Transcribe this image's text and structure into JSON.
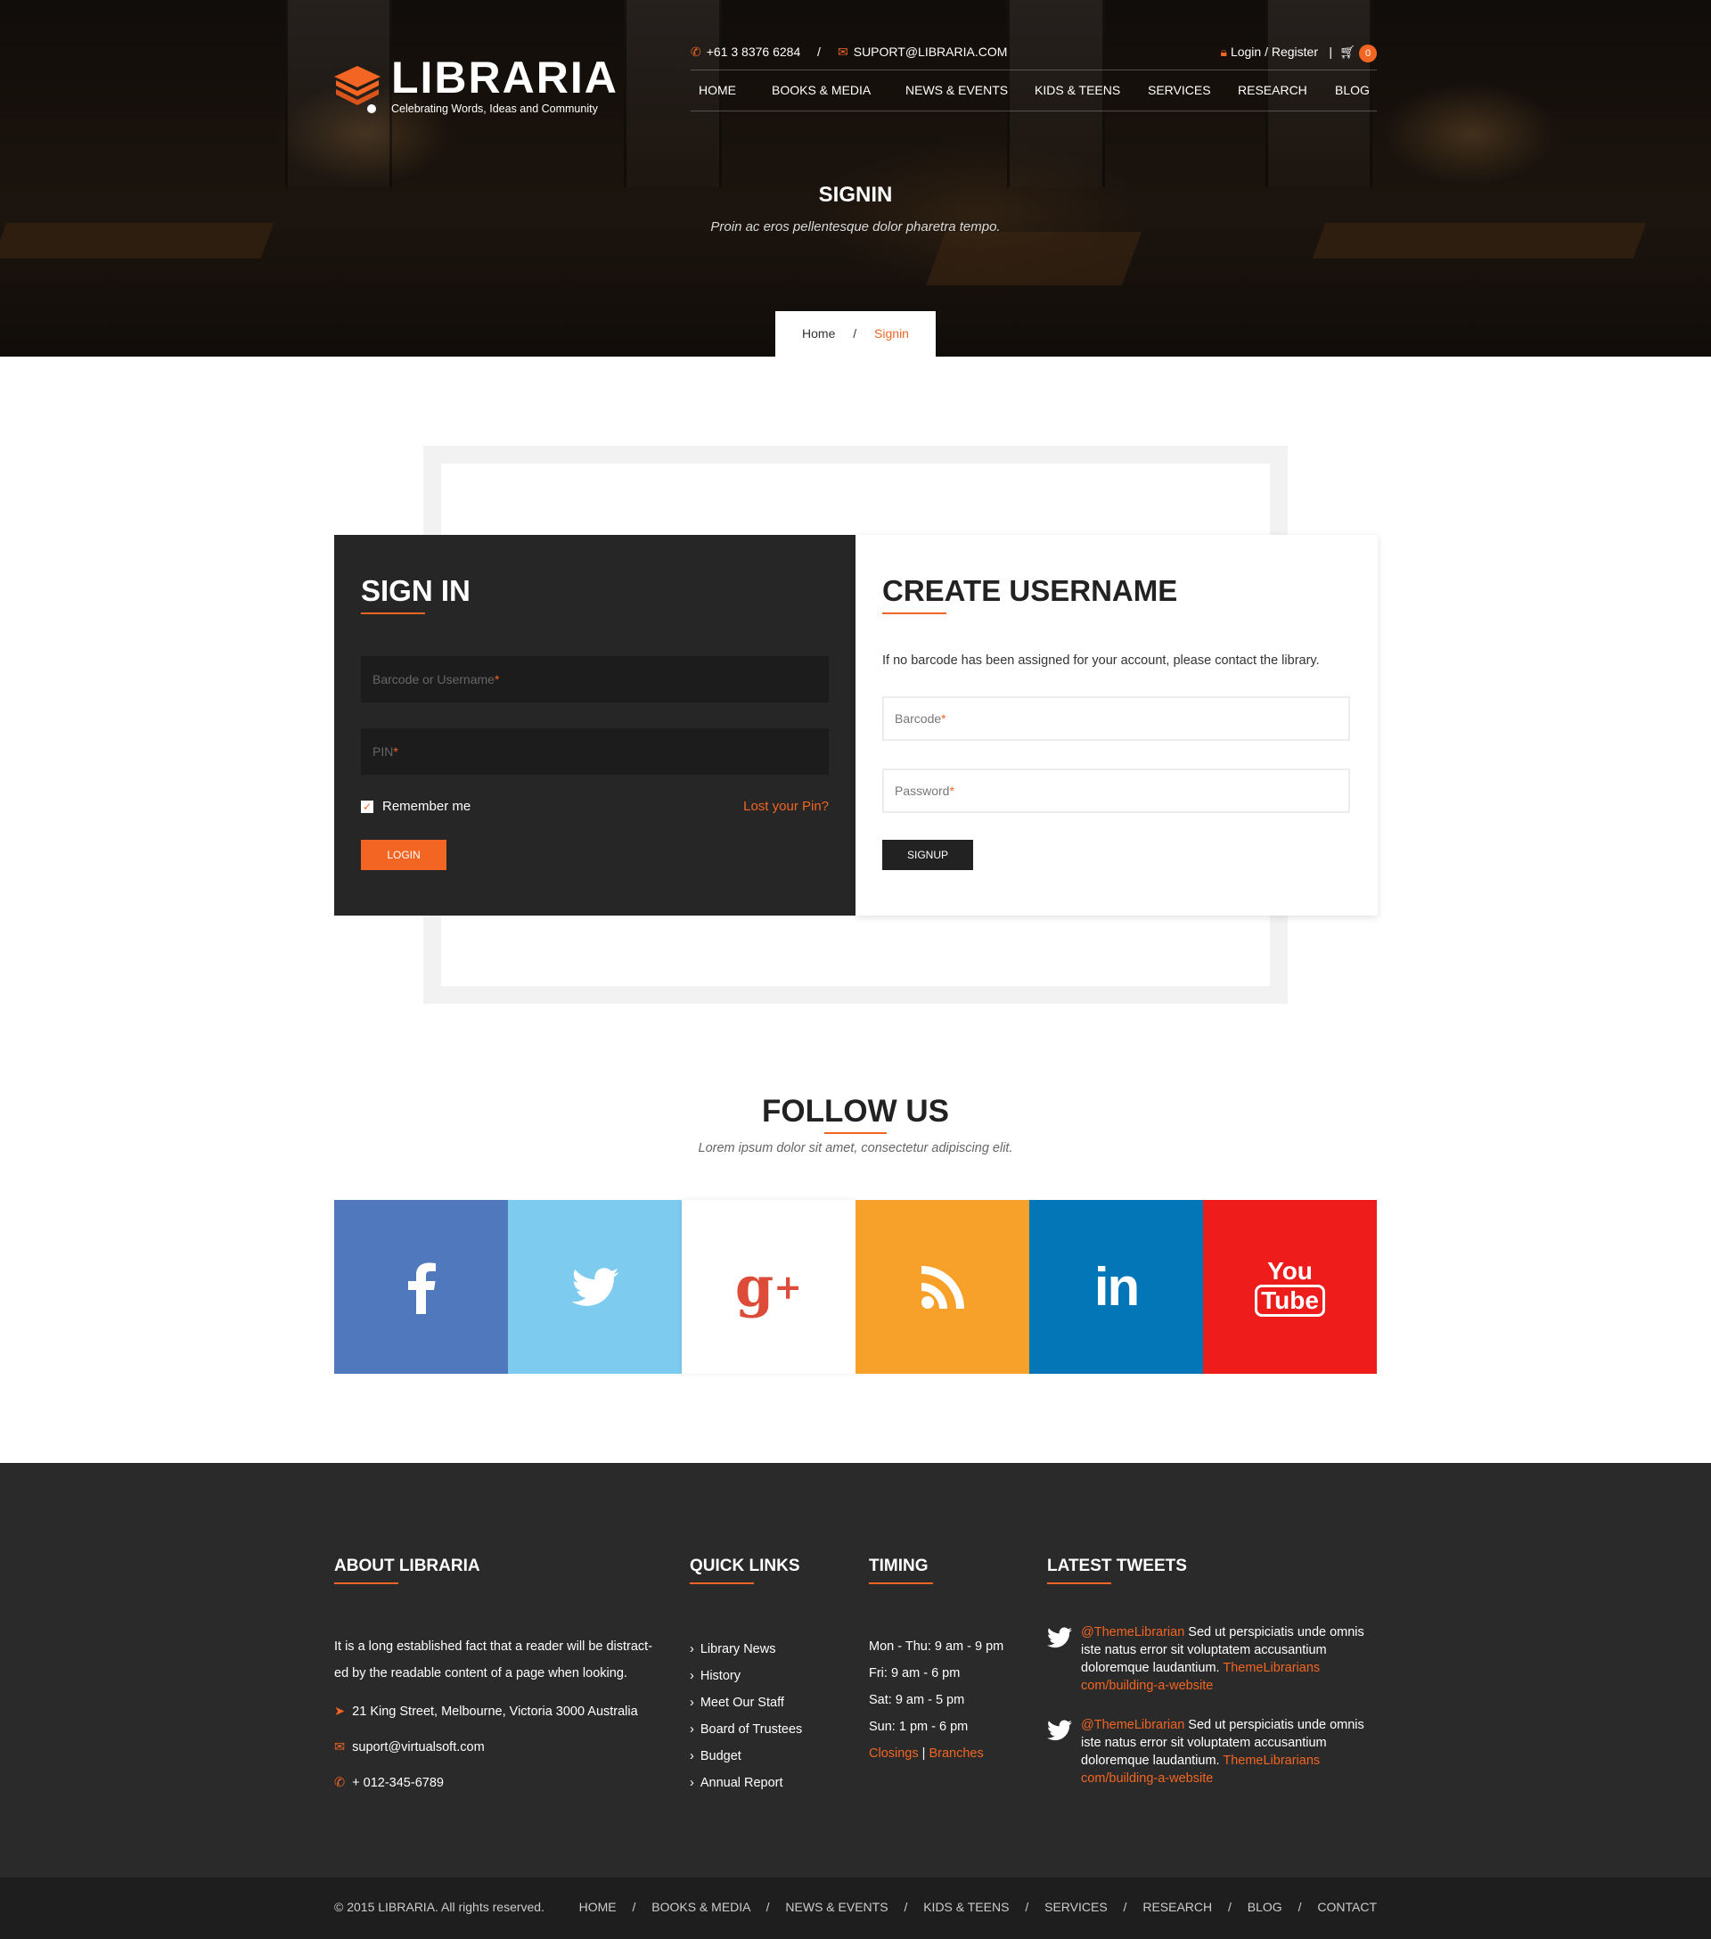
{
  "header": {
    "logo_name": "LIBRARIA",
    "logo_tagline": "Celebrating Words, Ideas and Community",
    "phone": "+61 3 8376 6284",
    "separator": "/",
    "email": "SUPORT@LIBRARIA.COM",
    "login_register": "Login / Register",
    "bar": "|",
    "cart_count": "0",
    "nav": [
      "HOME",
      "BOOKS & MEDIA",
      "NEWS & EVENTS",
      "KIDS & TEENS",
      "SERVICES",
      "RESEARCH",
      "BLOG"
    ]
  },
  "hero": {
    "title": "SIGNIN",
    "subtitle": "Proin ac eros pellentesque dolor pharetra tempo.",
    "breadcrumb_home": "Home",
    "breadcrumb_sep": "/",
    "breadcrumb_current": "Signin"
  },
  "signin": {
    "title": "SIGN IN",
    "username_placeholder": "Barcode or Username",
    "pin_placeholder": "PIN",
    "required_mark": "*",
    "remember_label": "Remember me",
    "remember_checked": true,
    "lost_pin": "Lost your Pin?",
    "login_button": "LOGIN"
  },
  "create": {
    "title": "CREATE USERNAME",
    "info": "If no barcode has been assigned for your account, please contact the library.",
    "barcode_placeholder": "Barcode",
    "password_placeholder": "Password",
    "signup_button": "SIGNUP"
  },
  "follow": {
    "title": "FOLLOW US",
    "subtitle": "Lorem ipsum dolor sit amet, consectetur adipiscing elit.",
    "networks": [
      {
        "name": "facebook",
        "color": "#5078bc"
      },
      {
        "name": "twitter",
        "color": "#7ecbf0"
      },
      {
        "name": "google-plus",
        "color": "#ffffff"
      },
      {
        "name": "rss",
        "color": "#f7a12a"
      },
      {
        "name": "linkedin",
        "color": "#0376b7"
      },
      {
        "name": "youtube",
        "color": "#ee1c1b"
      }
    ]
  },
  "footer": {
    "about": {
      "title": "ABOUT LIBRARIA",
      "text_line1": "It is a long established fact that a reader will be distract-",
      "text_line2": "ed by the readable content of a page when looking.",
      "address": "21 King Street, Melbourne, Victoria 3000 Australia",
      "email": "suport@virtualsoft.com",
      "phone": "+ 012-345-6789"
    },
    "quick_links": {
      "title": "QUICK LINKS",
      "items": [
        "Library News",
        "History",
        "Meet Our Staff",
        "Board of Trustees",
        "Budget",
        "Annual Report"
      ]
    },
    "timing": {
      "title": "TIMING",
      "rows": [
        "Mon - Thu: 9 am - 9 pm",
        "Fri: 9 am - 6 pm",
        "Sat: 9 am - 5 pm",
        "Sun: 1 pm - 6 pm"
      ],
      "closings": "Closings",
      "divider": "|",
      "branches": "Branches"
    },
    "tweets": {
      "title": "LATEST TWEETS",
      "items": [
        {
          "handle": "@ThemeLibrarian",
          "text": " Sed ut perspiciatis unde omnis iste natus error sit voluptatem accusantium doloremque laudantium. ",
          "link": "ThemeLibrarians com/building-a-website"
        },
        {
          "handle": "@ThemeLibrarian",
          "text": " Sed ut perspiciatis unde omnis iste natus error sit voluptatem accusantium doloremque laudantium. ",
          "link": "ThemeLibrarians com/building-a-website"
        }
      ]
    }
  },
  "bottom": {
    "copyright": "© 2015 LIBRARIA. All rights reserved.",
    "links": [
      "HOME",
      "BOOKS & MEDIA",
      "NEWS & EVENTS",
      "KIDS & TEENS",
      "SERVICES",
      "RESEARCH",
      "BLOG",
      "CONTACT"
    ],
    "separator": "/"
  },
  "colors": {
    "accent": "#f26522",
    "dark": "#262626",
    "footer": "#2a2a2a"
  }
}
